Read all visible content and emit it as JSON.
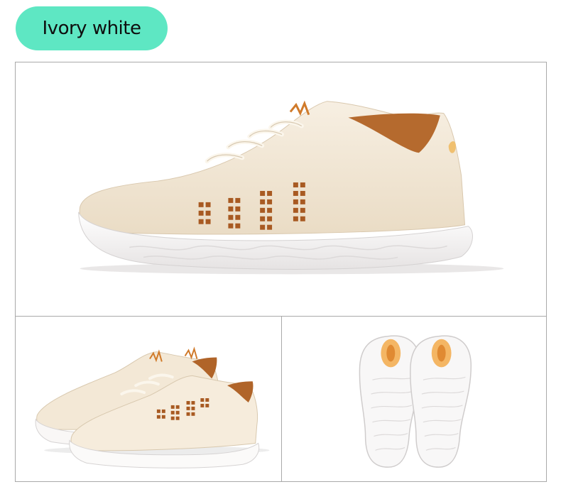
{
  "label": {
    "text": "Ivory white",
    "color": "#5ee7c3"
  },
  "photos": {
    "main": {
      "subject": "side-view-sneaker"
    },
    "pair": {
      "subject": "sneaker-pair-angle"
    },
    "soles": {
      "subject": "sneaker-outsoles"
    }
  },
  "colors": {
    "upper": "#f4ead9",
    "accent": "#a85a22",
    "sole": "#f8f6f4",
    "frame": "#a9a9a9"
  }
}
